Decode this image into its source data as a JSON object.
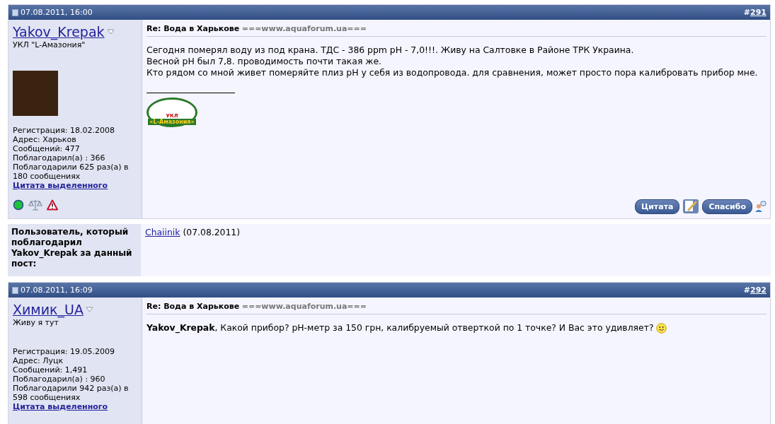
{
  "posts": [
    {
      "date": "07.08.2011, 16:00",
      "number_prefix": "#",
      "number": "291",
      "user": {
        "name": "Yakov_Krepak",
        "title": "УКЛ \"L-Амазония\"",
        "has_avatar": true,
        "stats": [
          "Регистрация: 18.02.2008",
          "Адрес: Харьков",
          "Сообщений: 477",
          "Поблагодарил(а) : 366",
          "Поблагодарили 625 раз(а) в 180 сообщениях"
        ],
        "quote_link": "Цитата выделенного",
        "online": true
      },
      "title": "Re: Вода в Харькове",
      "title_suffix": "===www.aquaforum.ua===",
      "lines": [
        "Сегодня померял воду из под крана. ТДС - 386 ppm pH - 7,0!!!. Живу на Салтовке в Районе ТРК Украина.",
        "Весной pH был 7,8. проводимость почти такая же.",
        "Кто рядом со мной живет померяйте плиз pH у себя из водопровода. для сравнения, может просто пора калибровать прибор мне."
      ],
      "smiley": false,
      "has_signature": true,
      "signature_logo": {
        "top": "УКЛ",
        "bottom": "«L-Амазония»"
      },
      "buttons": {
        "quote": "Цитата",
        "thanks": "Спасибо"
      },
      "thanks": {
        "label": "Пользователь, который поблагодарил **Yakov_Krepak** за данный пост:",
        "user": "Chaiinik",
        "date": "(07.08.2011)"
      }
    },
    {
      "date": "07.08.2011, 16:09",
      "number_prefix": "#",
      "number": "292",
      "user": {
        "name": "Химик_UA",
        "title": "Живу я тут",
        "has_avatar": false,
        "stats": [
          "Регистрация: 19.05.2009",
          "Адрес: Луцк",
          "Сообщений: 1,491",
          "Поблагодарил(а) : 960",
          "Поблагодарили 942 раз(а) в 598 сообщениях"
        ],
        "quote_link": "Цитата выделенного",
        "online": false
      },
      "title": "Re: Вода в Харькове",
      "title_suffix": "===www.aquaforum.ua===",
      "lines": [
        "**Yakov_Krepak**, Какой прибор? pH-метр за 150 грн, калибруемый отверткой по 1 точке? И Вас это удивляет?"
      ],
      "smiley": true,
      "has_signature": false
    }
  ]
}
